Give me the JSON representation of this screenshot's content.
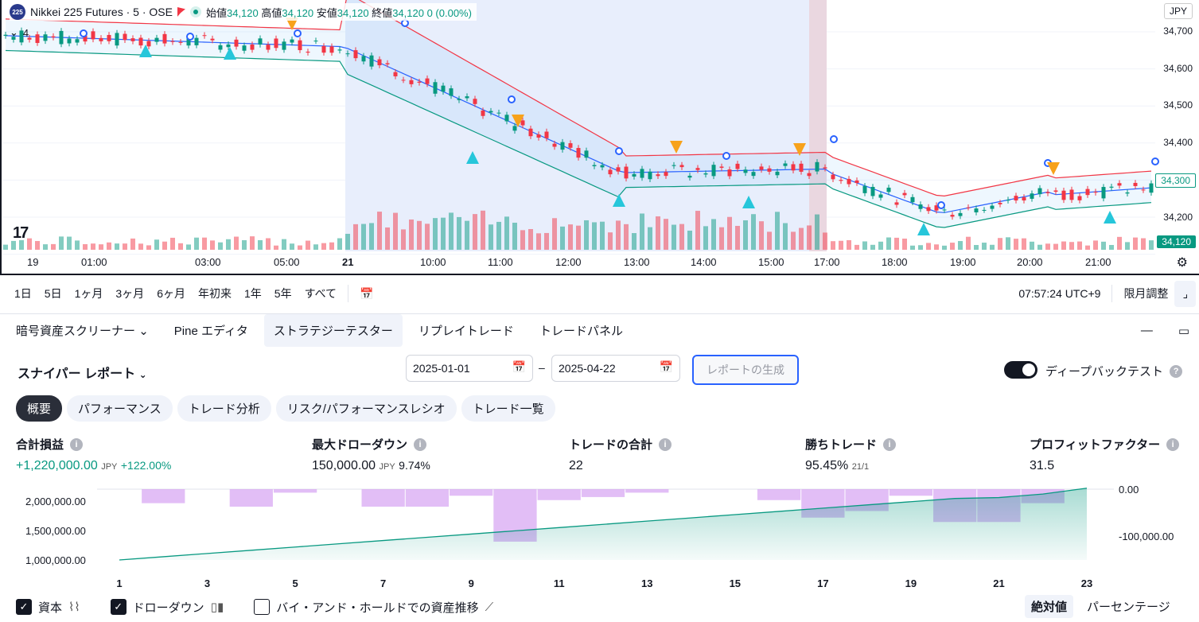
{
  "chart": {
    "symbol_badge": "225",
    "symbol": "Nikkei 225 Futures · 5 · OSE",
    "ohlc": {
      "open_label": "始値",
      "open": "34,120",
      "high_label": "高値",
      "high": "34,120",
      "low_label": "安値",
      "low": "34,120",
      "close_label": "終値",
      "close": "34,120",
      "change": "0 (0.00%)"
    },
    "indicator_count": "4",
    "currency": "JPY",
    "price_ticks": [
      "34,700",
      "34,600",
      "34,500",
      "34,400",
      "34,300",
      "34,200"
    ],
    "price_tag_blue": "34,300",
    "price_tag_green": "34,120",
    "time_ticks": [
      "19",
      "01:00",
      "03:00",
      "05:00",
      "21",
      "10:00",
      "11:00",
      "12:00",
      "13:00",
      "14:00",
      "15:00",
      "17:00",
      "18:00",
      "19:00",
      "20:00",
      "21:00"
    ],
    "colors": {
      "up": "#089981",
      "down": "#f23645",
      "mid": "#2962ff",
      "fill": "#e3ecfd"
    }
  },
  "toolbar": {
    "ranges": [
      "1日",
      "5日",
      "1ヶ月",
      "3ヶ月",
      "6ヶ月",
      "年初来",
      "1年",
      "5年",
      "すべて"
    ],
    "clock": "07:57:24 UTC+9",
    "adjust": "限月調整"
  },
  "panel_tabs": [
    "暗号資産スクリーナー",
    "Pine エディタ",
    "ストラテジーテスター",
    "リプレイトレード",
    "トレードパネル"
  ],
  "report": {
    "title": "スナイパー レポート",
    "date_from": "2025-01-01",
    "date_sep": "–",
    "date_to": "2025-04-22",
    "generate": "レポートの生成",
    "deep_backtest": "ディープバックテスト"
  },
  "subtabs": [
    "概要",
    "パフォーマンス",
    "トレード分析",
    "リスク/パフォーマンスレシオ",
    "トレード一覧"
  ],
  "metrics": {
    "net_profit": {
      "label": "合計損益",
      "value": "+1,220,000.00",
      "unit": "JPY",
      "pct": "+122.00%"
    },
    "max_dd": {
      "label": "最大ドローダウン",
      "value": "150,000.00",
      "unit": "JPY",
      "pct": "9.74%"
    },
    "trades": {
      "label": "トレードの合計",
      "value": "22"
    },
    "win": {
      "label": "勝ちトレード",
      "value": "95.45%",
      "ratio": "21/1"
    },
    "pf": {
      "label": "プロフィットファクター",
      "value": "31.5"
    }
  },
  "chart_data": {
    "type": "bar",
    "title": "",
    "x": [
      1,
      2,
      3,
      4,
      5,
      6,
      7,
      8,
      9,
      10,
      11,
      12,
      13,
      14,
      15,
      16,
      17,
      18,
      19,
      20,
      21,
      22,
      23
    ],
    "x_tick_labels": [
      "1",
      "3",
      "5",
      "7",
      "9",
      "11",
      "13",
      "15",
      "17",
      "19",
      "21",
      "23"
    ],
    "left_axis_ticks": [
      "2,000,000.00",
      "1,500,000.00",
      "1,000,000.00"
    ],
    "right_axis_ticks": [
      "0.00",
      "-100,000.00"
    ],
    "series": [
      {
        "name": "資本",
        "type": "area",
        "values": [
          1000000,
          1055000,
          1110000,
          1165000,
          1220000,
          1275000,
          1330000,
          1385000,
          1440000,
          1495000,
          1550000,
          1605000,
          1660000,
          1715000,
          1770000,
          1825000,
          1880000,
          1935000,
          1990000,
          2045000,
          2060000,
          2120000,
          2220000
        ]
      },
      {
        "name": "ドローダウン",
        "type": "bar",
        "values": [
          0,
          -32000,
          0,
          -40000,
          -8000,
          0,
          -40000,
          -40000,
          -15000,
          -120000,
          -25000,
          -18000,
          -8000,
          0,
          0,
          -25000,
          -65000,
          -50000,
          -15000,
          -75000,
          -75000,
          -32000,
          0
        ]
      }
    ],
    "legend": [
      "資本",
      "ドローダウン",
      "バイ・アンド・ホールドでの資産推移"
    ]
  },
  "bottom_options": {
    "equity": "資本",
    "drawdown": "ドローダウン",
    "buy_hold": "バイ・アンド・ホールドでの資産推移",
    "absolute": "絶対値",
    "percentage": "パーセンテージ"
  }
}
